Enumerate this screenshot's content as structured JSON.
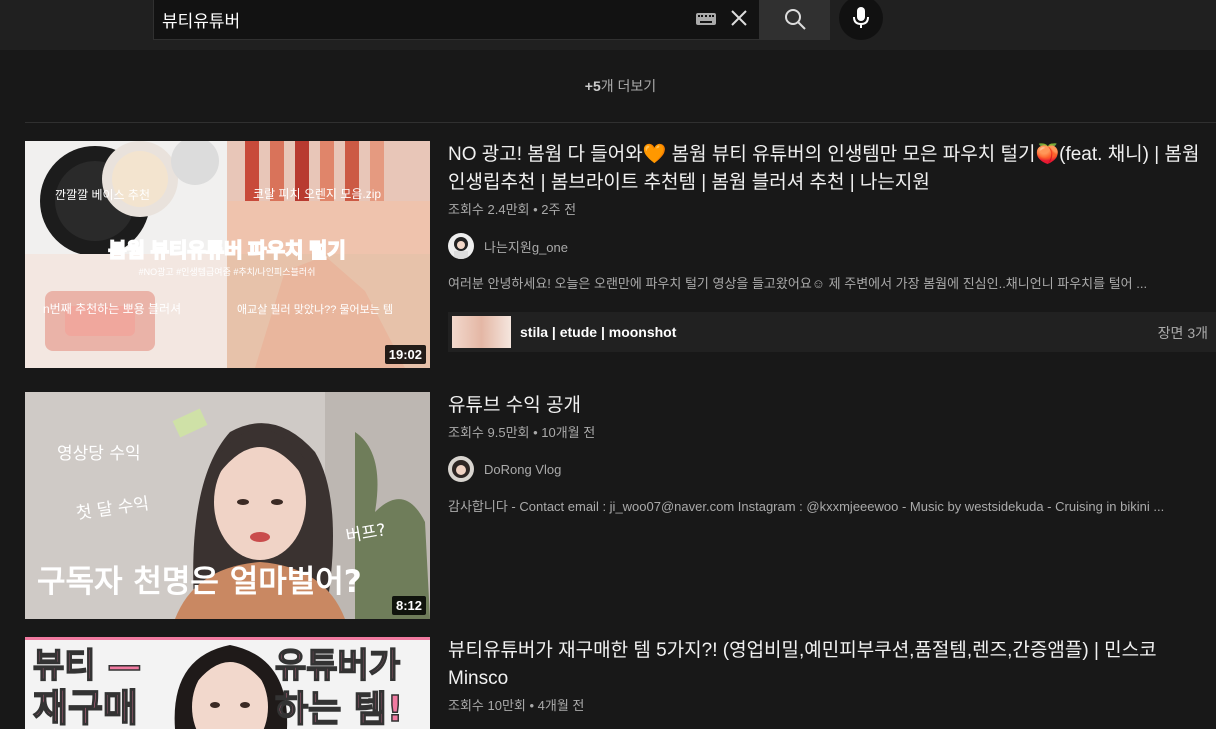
{
  "search": {
    "query": "뷰티유튜버"
  },
  "icons": {
    "keyboard": "keyboard-icon",
    "clear": "close-icon",
    "search": "search-icon",
    "mic": "mic-icon"
  },
  "more": {
    "count": "+5",
    "suffix": "개 더보기"
  },
  "results": [
    {
      "title": "NO 광고! 봄웜 다 들어와🧡 봄웜 뷰티 유튜버의 인생템만 모은 파우치 털기🍑(feat. 채니) | 봄웜 인생립추천 | 봄브라이트 추천템 | 봄웜 블러셔 추천 | 나는지원",
      "views": "조회수 2.4만회",
      "age": "2주 전",
      "channel": "나는지원g_one",
      "description": "여러분 안녕하세요! 오늘은 오랜만에 파우치 털기 영상을 들고왔어요☺ 제 주변에서 가장 봄웜에 진심인..채니언니 파우치를 털어 ...",
      "duration": "19:02",
      "thumb_text": {
        "main": "봄웜 뷰티유튜버 파우치 털기",
        "tags": "#NO광고 #인생템급여줌 #추치/나인피스블러쉬",
        "tl": "깐깔깔 베이스 추천",
        "tr": "코랄 피치 오렌지 모음.zip",
        "bl": "n번째 추천하는 뽀용 블러셔",
        "br": "애교살 필러 맞았나?? 물어보는 템"
      },
      "chapters": {
        "title": "stila | etude | moonshot",
        "count": "장면 3개"
      }
    },
    {
      "title": "유튜브 수익 공개",
      "views": "조회수 9.5만회",
      "age": "10개월 전",
      "channel": "DoRong Vlog",
      "description": "감사합니다 - Contact email : ji_woo07@naver.com Instagram : @kxxmjeeewoo - Music by westsidekuda - Cruising in bikini ...",
      "duration": "8:12",
      "thumb_text": {
        "a": "영상당 수익",
        "b": "첫 달 수익",
        "c": "버프?",
        "main": "구독자 천명은 얼마벌어?"
      }
    },
    {
      "title": "뷰티유튜버가 재구매한 템 5가지?! (영업비밀,예민피부쿠션,품절템,렌즈,간증앰플) | 민스코 Minsco",
      "views": "조회수 10만회",
      "age": "4개월 전",
      "thumb_text": {
        "tl1": "뷰티 —",
        "tl2": "재구매",
        "tr1": "유튜버가",
        "tr2": "하는 템!"
      }
    }
  ]
}
